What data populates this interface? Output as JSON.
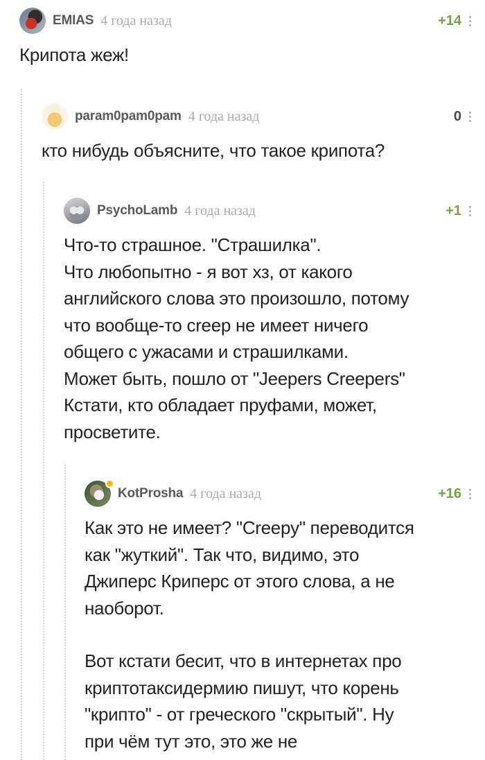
{
  "comments": [
    {
      "user": "EMIAS",
      "time": "4 года назад",
      "rating": "+14",
      "avatar_icon": "bullfinch-avatar",
      "lines": [
        "Крипота жеж!"
      ]
    },
    {
      "user": "param0pam0pam",
      "time": "4 года назад",
      "rating": "0",
      "avatar_icon": "chef-avatar",
      "lines": [
        "кто нибудь объясните, что такое крипота?"
      ]
    },
    {
      "user": "PsychoLamb",
      "time": "4 года назад",
      "rating": "+1",
      "avatar_icon": "lamb-avatar",
      "lines": [
        "Что-то страшное. \"Страшилка\".",
        "Что любопытно - я вот хз, от какого",
        "английского слова это произошло, потому",
        "что вообще-то creep не имеет ничего",
        "общего с ужасами и страшилками.",
        "Может быть, пошло от \"Jeepers Creepers\"",
        "Кстати, кто обладает пруфами, может,",
        "просветите."
      ]
    },
    {
      "user": "KotProsha",
      "time": "4 года назад",
      "rating": "+16",
      "avatar_icon": "cat-avatar",
      "online": true,
      "lines": [
        "Как это не имеет? \"Creepy\" переводится",
        "как \"жуткий\". Так что, видимо, это",
        "Джиперс Криперс от этого слова, а не",
        "наоборот."
      ],
      "lines2": [
        "Вот кстати бесит, что в интернетах про",
        "криптотаксидермию пишут, что корень",
        "\"крипто\" - от греческого \"скрытый\". Ну",
        "при чём тут это, это же не"
      ]
    }
  ],
  "colors": {
    "rating_positive": "#72a24a",
    "rating_zero": "#4a4a4a",
    "username": "#555a5f",
    "timestamp": "#a9acaf",
    "online_dot": "#f3b71a"
  }
}
